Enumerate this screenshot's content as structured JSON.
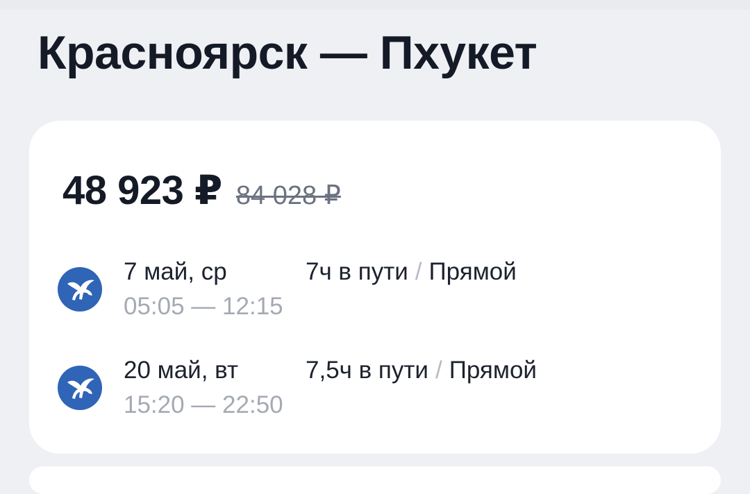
{
  "route": {
    "title": "Красноярск — Пхукет"
  },
  "ticket": {
    "price": "48 923 ₽",
    "old_price": "84 028 ₽",
    "segments": [
      {
        "airline_icon": "pegasus-airline-logo-icon",
        "date": "7 май, ср",
        "times": "05:05 — 12:15",
        "duration": "7ч в пути",
        "separator": "/",
        "stops": "Прямой"
      },
      {
        "airline_icon": "pegasus-airline-logo-icon",
        "date": "20 май, вт",
        "times": "15:20 — 22:50",
        "duration": "7,5ч в пути",
        "separator": "/",
        "stops": "Прямой"
      }
    ]
  },
  "colors": {
    "background": "#eef0f4",
    "card": "#ffffff",
    "airline_logo": "#2f64b6",
    "primary_text": "#141b26",
    "muted_text": "#a4aab3"
  }
}
